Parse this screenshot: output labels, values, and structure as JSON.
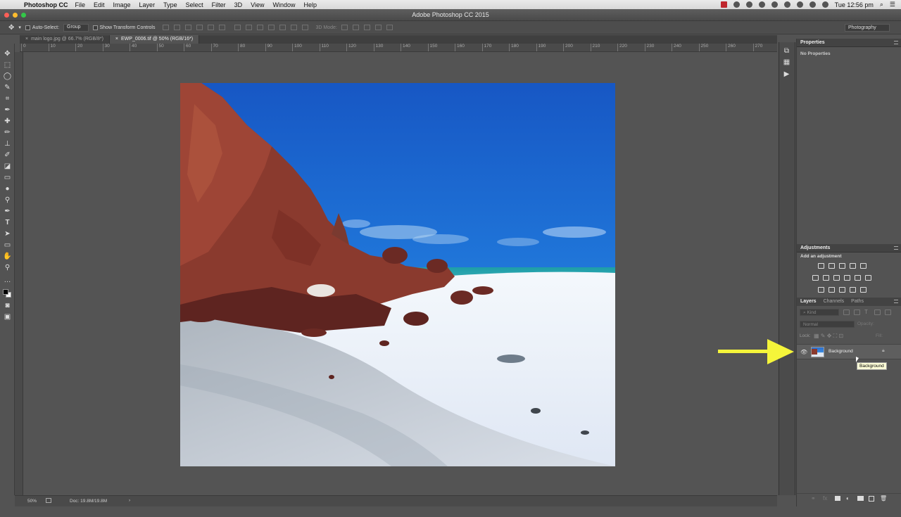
{
  "menubar": {
    "app_name": "Photoshop CC",
    "menus": [
      "File",
      "Edit",
      "Image",
      "Layer",
      "Type",
      "Select",
      "Filter",
      "3D",
      "View",
      "Window",
      "Help"
    ],
    "clock": "Tue 12:56 pm"
  },
  "window": {
    "title": "Adobe Photoshop CC 2015"
  },
  "options": {
    "auto_select_label": "Auto-Select:",
    "auto_select_value": "Group",
    "transform_label": "Show Transform Controls",
    "mode_3d": "3D Mode:",
    "workspace": "Photography"
  },
  "tabs": [
    {
      "label": "main logo.jpg @ 66.7% (RGB/8*)",
      "active": false
    },
    {
      "label": "EWP_0006.tif @ 50% (RGB/16*)",
      "active": true
    }
  ],
  "ruler_ticks": [
    "0",
    "10",
    "20",
    "30",
    "40",
    "50",
    "60",
    "70",
    "80",
    "90",
    "100",
    "110",
    "120",
    "130",
    "140",
    "150",
    "160",
    "170",
    "180",
    "190",
    "200",
    "210",
    "220",
    "230",
    "240",
    "250",
    "260",
    "270",
    "280"
  ],
  "status": {
    "zoom": "50%",
    "doc": "Doc: 19.8M/19.8M"
  },
  "properties": {
    "title": "Properties",
    "empty_text": "No Properties"
  },
  "adjustments": {
    "title": "Adjustments",
    "add_label": "Add an adjustment"
  },
  "layers_panel": {
    "tabs": [
      "Layers",
      "Channels",
      "Paths"
    ],
    "search_placeholder": "Kind",
    "blend_mode": "Normal",
    "opacity_label": "Opacity:",
    "lock_label": "Lock:",
    "fill_label": "Fill:",
    "layer_name": "Background",
    "tooltip": "Background"
  },
  "colors": {
    "accent_arrow": "#f5f53a",
    "panel_bg": "#535353",
    "canvas_bg": "#545454"
  }
}
